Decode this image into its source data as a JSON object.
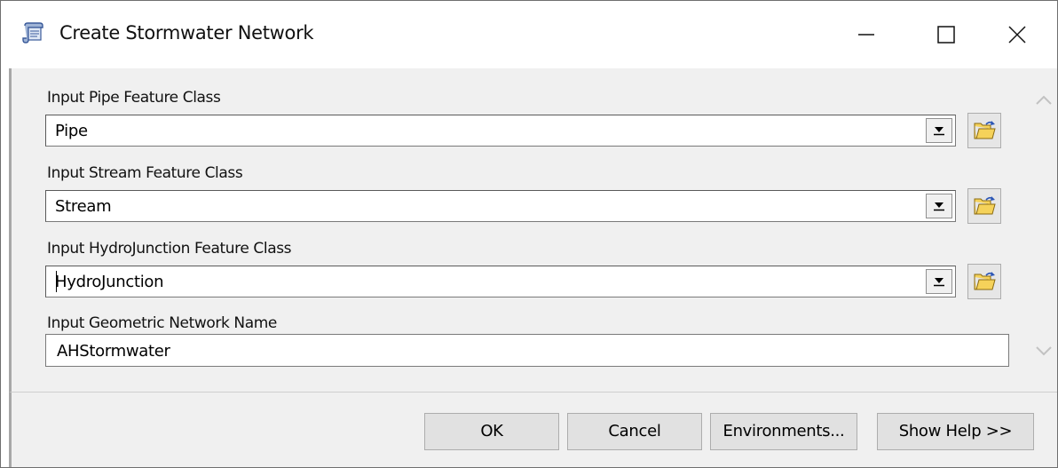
{
  "window": {
    "title": "Create Stormwater Network",
    "icon": "script-tool-icon"
  },
  "params": [
    {
      "label": "Input Pipe Feature Class",
      "value": "Pipe"
    },
    {
      "label": "Input Stream Feature Class",
      "value": "Stream"
    },
    {
      "label": "Input HydroJunction Feature Class",
      "value": "HydroJunction"
    }
  ],
  "network_name": {
    "label": "Input Geometric Network Name",
    "value": "AHStormwater"
  },
  "footer": {
    "ok": "OK",
    "cancel": "Cancel",
    "environments": "Environments...",
    "show_help": "Show Help >>"
  },
  "colors": {
    "panel": "#f0f0f0",
    "folder_yellow": "#f5d25a"
  }
}
